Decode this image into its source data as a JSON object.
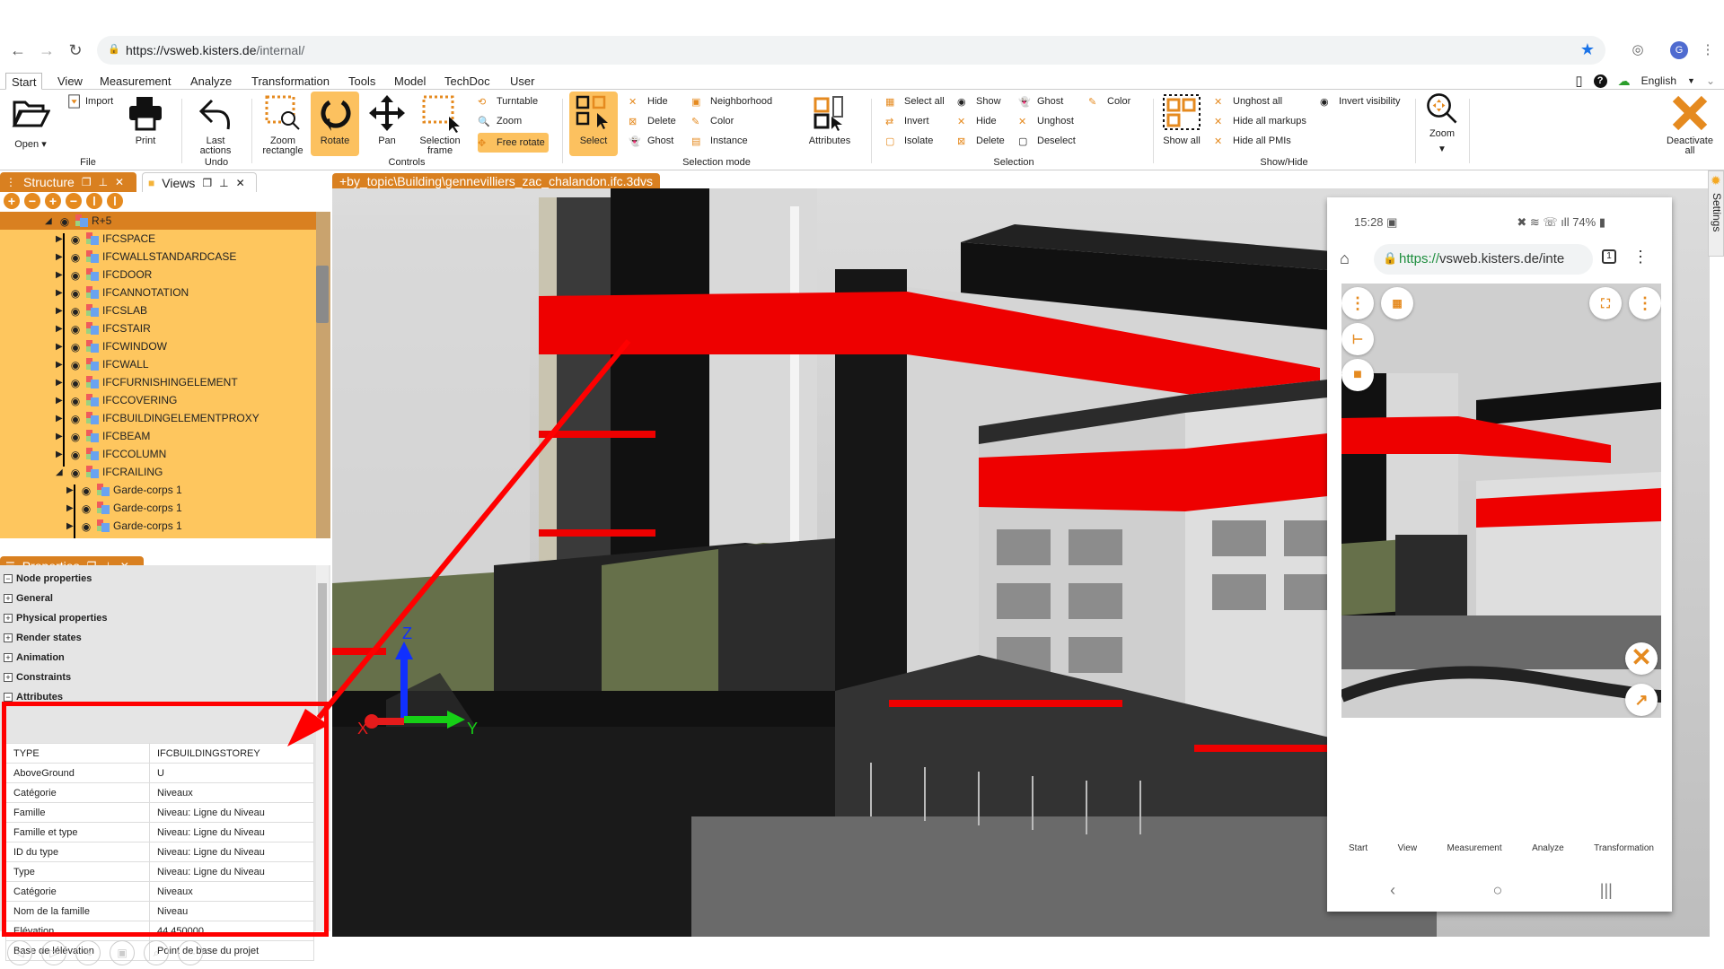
{
  "browser": {
    "url_host": "https://vsweb.kisters.de",
    "url_path": "/internal/",
    "avatar_letter": "G"
  },
  "menu": {
    "tabs": [
      "Start",
      "View",
      "Measurement",
      "Analyze",
      "Transformation",
      "Tools",
      "Model",
      "TechDoc",
      "User"
    ],
    "active": "Start",
    "language": "English"
  },
  "ribbon": {
    "file": {
      "label": "File",
      "open": "Open",
      "import": "Import",
      "print": "Print"
    },
    "undo": {
      "label": "Undo",
      "last_actions": "Last actions"
    },
    "controls": {
      "label": "Controls",
      "zoom_rectangle": "Zoom rectangle",
      "rotate": "Rotate",
      "pan": "Pan",
      "selection_frame": "Selection frame",
      "turntable": "Turntable",
      "zoom": "Zoom",
      "free_rotate": "Free rotate"
    },
    "selection_mode": {
      "label": "Selection mode",
      "select": "Select",
      "hide": "Hide",
      "delete": "Delete",
      "ghost": "Ghost",
      "neighborhood": "Neighborhood",
      "color": "Color",
      "instance": "Instance",
      "attributes": "Attributes"
    },
    "selection": {
      "label": "Selection",
      "select_all": "Select all",
      "invert": "Invert",
      "isolate": "Isolate",
      "show": "Show",
      "hide": "Hide",
      "delete": "Delete",
      "ghost": "Ghost",
      "unghost": "Unghost",
      "deselect": "Deselect",
      "color": "Color"
    },
    "show_hide": {
      "label": "Show/Hide",
      "show_all": "Show all",
      "unghost_all": "Unghost all",
      "hide_all_markups": "Hide all markups",
      "hide_all_pmis": "Hide all PMIs",
      "invert_visibility": "Invert visibility"
    },
    "zoom": {
      "label": "Zoom"
    },
    "deactivate": {
      "label": "Deactivate all"
    }
  },
  "structure_panel": {
    "tab_structure": "Structure",
    "tab_views": "Views",
    "tree": [
      {
        "label": "R+5",
        "level": 0,
        "expanded": true,
        "selected": true
      },
      {
        "label": "IFCSPACE",
        "level": 1
      },
      {
        "label": "IFCWALLSTANDARDCASE",
        "level": 1
      },
      {
        "label": "IFCDOOR",
        "level": 1
      },
      {
        "label": "IFCANNOTATION",
        "level": 1
      },
      {
        "label": "IFCSLAB",
        "level": 1
      },
      {
        "label": "IFCSTAIR",
        "level": 1
      },
      {
        "label": "IFCWINDOW",
        "level": 1
      },
      {
        "label": "IFCWALL",
        "level": 1
      },
      {
        "label": "IFCFURNISHINGELEMENT",
        "level": 1
      },
      {
        "label": "IFCCOVERING",
        "level": 1
      },
      {
        "label": "IFCBUILDINGELEMENTPROXY",
        "level": 1
      },
      {
        "label": "IFCBEAM",
        "level": 1
      },
      {
        "label": "IFCCOLUMN",
        "level": 1
      },
      {
        "label": "IFCRAILING",
        "level": 1,
        "expanded": true
      },
      {
        "label": "Garde-corps 1",
        "level": 2
      },
      {
        "label": "Garde-corps 1",
        "level": 2
      },
      {
        "label": "Garde-corps 1",
        "level": 2
      }
    ]
  },
  "properties_panel": {
    "title": "Properties",
    "sections": [
      {
        "label": "Node properties",
        "expanded": true
      },
      {
        "label": "General",
        "expanded": false
      },
      {
        "label": "Physical properties",
        "expanded": false
      },
      {
        "label": "Render states",
        "expanded": false
      },
      {
        "label": "Animation",
        "expanded": false
      },
      {
        "label": "Constraints",
        "expanded": false
      },
      {
        "label": "Attributes",
        "expanded": true
      }
    ],
    "attributes": [
      {
        "key": "TYPE",
        "value": "IFCBUILDINGSTOREY"
      },
      {
        "key": "AboveGround",
        "value": "U"
      },
      {
        "key": "Catégorie",
        "value": "Niveaux"
      },
      {
        "key": "Famille",
        "value": "Niveau: Ligne du Niveau"
      },
      {
        "key": "Famille et type",
        "value": "Niveau: Ligne du Niveau"
      },
      {
        "key": "ID du type",
        "value": "Niveau: Ligne du Niveau"
      },
      {
        "key": "Type",
        "value": "Niveau: Ligne du Niveau"
      },
      {
        "key": "Catégorie",
        "value": "Niveaux"
      },
      {
        "key": "Nom de la famille",
        "value": "Niveau"
      },
      {
        "key": "Elévation",
        "value": "44.450000"
      },
      {
        "key": "Base de lélévation",
        "value": "Point de base du projet"
      }
    ]
  },
  "viewport": {
    "file_tab": "+by_topic\\Building\\gennevilliers_zac_chalandon.ifc.3dvs",
    "axis_labels": {
      "x": "X",
      "y": "Y",
      "z": "Z"
    },
    "settings_label": "Settings"
  },
  "phone": {
    "time": "15:28",
    "battery": "74%",
    "url_host": "https://",
    "url_rest": "vsweb.kisters.de/inte",
    "tab_count": "1",
    "tabs": [
      "Start",
      "View",
      "Measurement",
      "Analyze",
      "Transformation"
    ]
  },
  "colors": {
    "accent": "#d98020",
    "tree_bg": "#fec65e",
    "highlight": "#fcc15f",
    "annotation": "#ff0000"
  }
}
